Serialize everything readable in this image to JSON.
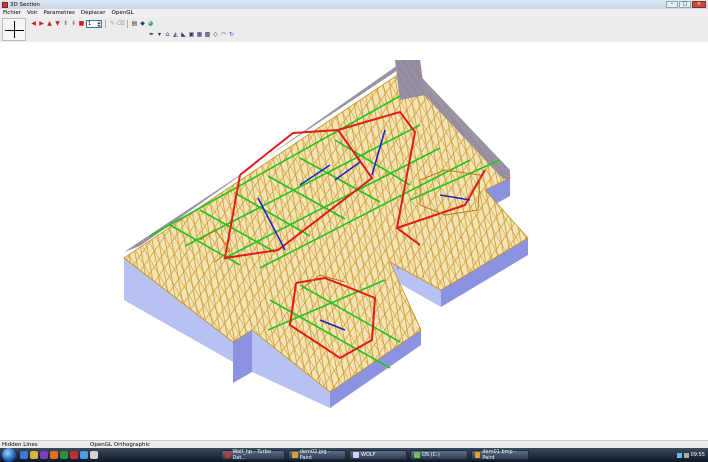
{
  "window": {
    "title": "3D Section"
  },
  "menu": [
    "Fichier",
    "Voir",
    "Parametres",
    "Deplacer",
    "OpenGL"
  ],
  "toolbar": {
    "spin_value": "1"
  },
  "status": {
    "left": "Hidden Lines",
    "right": "OpenGL Orthographic"
  },
  "taskbar": {
    "tasks": [
      {
        "label": "Wolf_hp - Turbo Dat...",
        "color": "#c0392b"
      },
      {
        "label": "dem02.jpg - Paint",
        "color": "#e0a030"
      },
      {
        "label": "WOLF",
        "color": "#d0d0ff"
      },
      {
        "label": "OS (C:)",
        "color": "#6fbf5f"
      },
      {
        "label": "dem01.bmp - Paint",
        "color": "#e0a030"
      }
    ],
    "clock": "09:55"
  },
  "colors": {
    "wall_face": "#8b93e0",
    "wall_side": "#b7c1f2",
    "roof": "#8f8aa7",
    "timber": "#d8a52a",
    "red": "#e11a1a",
    "green": "#22c21f",
    "blue": "#1d23c8"
  }
}
